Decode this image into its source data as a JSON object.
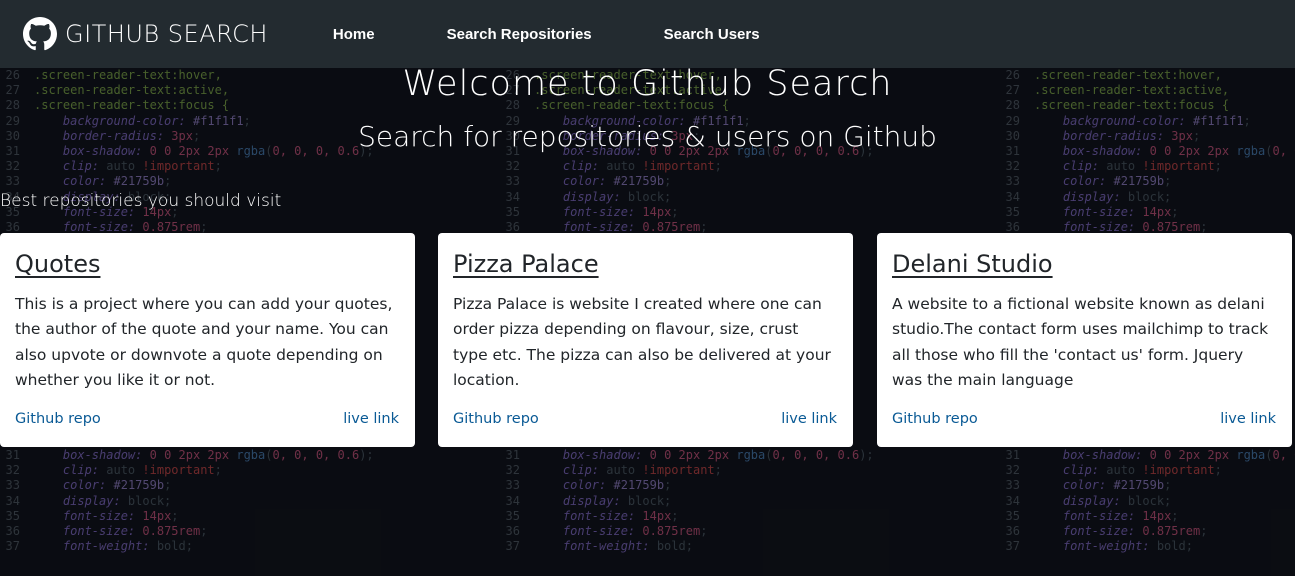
{
  "navbar": {
    "brand": "GITHUB SEARCH",
    "brand_icon": "github-icon",
    "links": [
      {
        "label": "Home"
      },
      {
        "label": "Search Repositories"
      },
      {
        "label": "Search Users"
      }
    ]
  },
  "hero": {
    "title": "Welcome to Github Search",
    "subtitle": "Search for repositories & users on Github"
  },
  "section_title": "Best repositories you should visit",
  "cards": [
    {
      "title": "Quotes",
      "description": "This is a project where you can add your quotes, the author of the quote and your name. You can also upvote or downvote a quote depending on whether you like it or not.",
      "repo_label": "Github repo",
      "live_label": "live link"
    },
    {
      "title": "Pizza Palace",
      "description": "Pizza Palace is website I created where one can order pizza depending on flavour, size, crust type etc. The pizza can also be delivered at your location.",
      "repo_label": "Github repo",
      "live_label": "live link"
    },
    {
      "title": "Delani Studio",
      "description": "A website to a fictional website known as delani studio.The contact form uses mailchimp to track all those who fill the 'contact us' form. Jquery was the main language",
      "repo_label": "Github repo",
      "live_label": "live link"
    }
  ],
  "colors": {
    "navbar_bg": "#232b30",
    "card_bg": "#ffffff",
    "link": "#0a5a95",
    "text": "#212529"
  }
}
